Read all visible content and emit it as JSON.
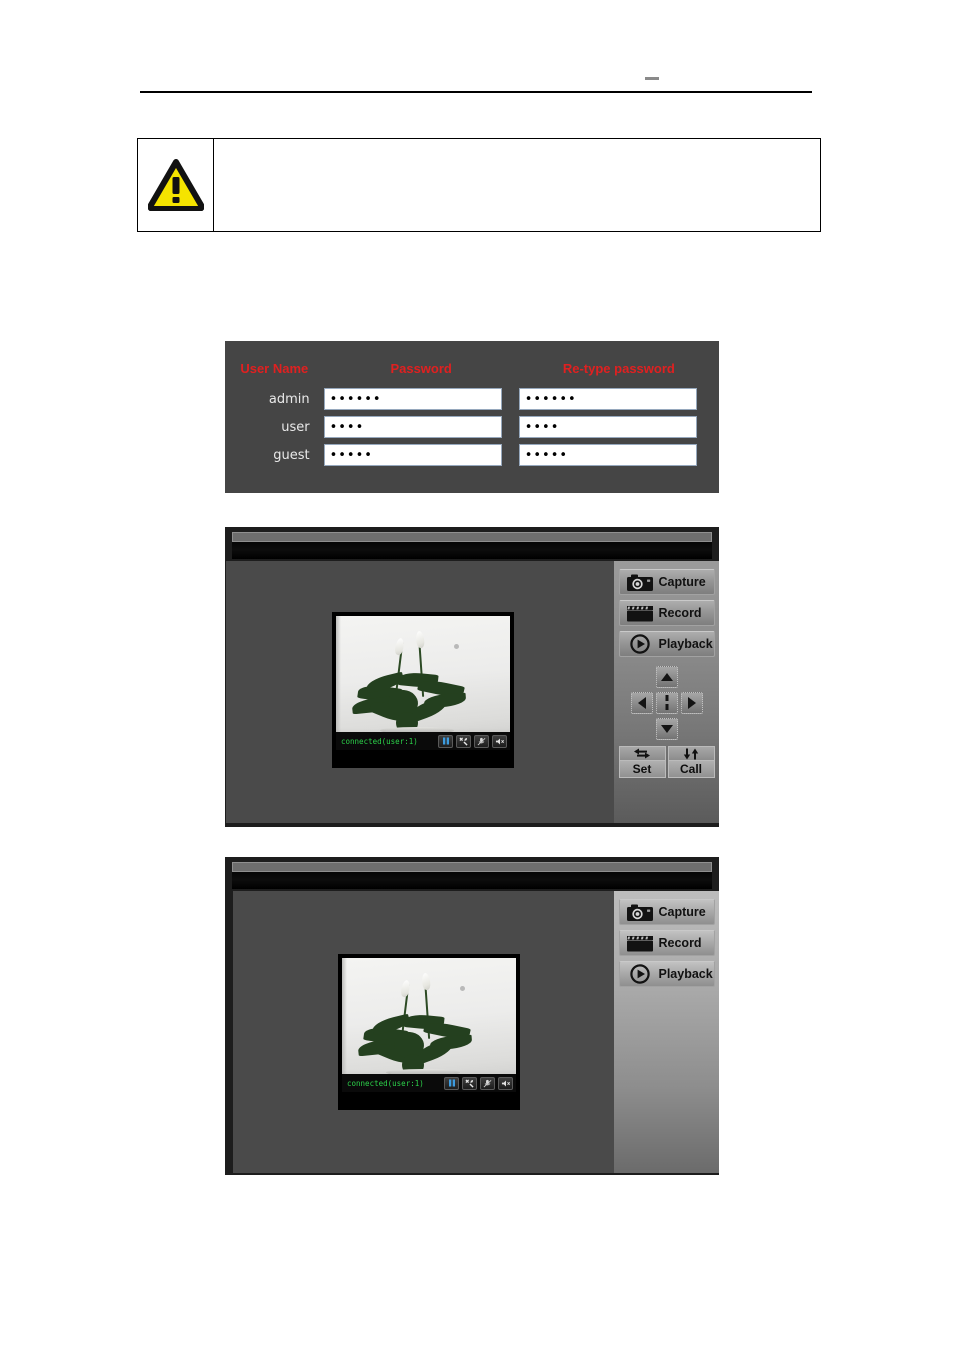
{
  "page": {
    "header_rule": true,
    "header_dash": "–"
  },
  "note": {
    "icon": "warning-triangle-icon",
    "text": ""
  },
  "password_table": {
    "panel_bg": "#454545",
    "header_color": "#e02020",
    "columns": [
      "User Name",
      "Password",
      "Re-type password"
    ],
    "rows": [
      {
        "user": "admin",
        "password_dots": "••••••",
        "retype_dots": "••••••"
      },
      {
        "user": "user",
        "password_dots": "••••",
        "retype_dots": "••••"
      },
      {
        "user": "guest",
        "password_dots": "•••••",
        "retype_dots": "•••••"
      }
    ]
  },
  "viewers": [
    {
      "id": "viewer-1",
      "status_text": "connected(user:1)",
      "status_color": "#2cd14a",
      "status_buttons": [
        {
          "name": "pause-button",
          "glyph": "pause"
        },
        {
          "name": "tools-button",
          "glyph": "wrench"
        },
        {
          "name": "microphone-mute-button",
          "glyph": "mic-off"
        },
        {
          "name": "speaker-mute-button",
          "glyph": "speaker-off"
        }
      ],
      "controls": [
        {
          "label": "Capture",
          "icon": "camera-icon"
        },
        {
          "label": "Record",
          "icon": "clapperboard-icon"
        },
        {
          "label": "Playback",
          "icon": "play-circle-icon"
        }
      ],
      "ptz": {
        "present": true,
        "directions": [
          "up",
          "left",
          "center",
          "right",
          "down"
        ],
        "preset_buttons": [
          {
            "label": "Set",
            "icon": "pan-arrows-icon"
          },
          {
            "label": "Call",
            "icon": "tilt-arrows-icon"
          }
        ]
      }
    },
    {
      "id": "viewer-2",
      "status_text": "connected(user:1)",
      "status_color": "#2cd14a",
      "status_buttons": [
        {
          "name": "pause-button",
          "glyph": "pause"
        },
        {
          "name": "tools-button",
          "glyph": "wrench"
        },
        {
          "name": "microphone-mute-button",
          "glyph": "mic-off"
        },
        {
          "name": "speaker-mute-button",
          "glyph": "speaker-off"
        }
      ],
      "controls": [
        {
          "label": "Capture",
          "icon": "camera-icon"
        },
        {
          "label": "Record",
          "icon": "clapperboard-icon"
        },
        {
          "label": "Playback",
          "icon": "play-circle-icon"
        }
      ],
      "ptz": {
        "present": false
      }
    }
  ]
}
